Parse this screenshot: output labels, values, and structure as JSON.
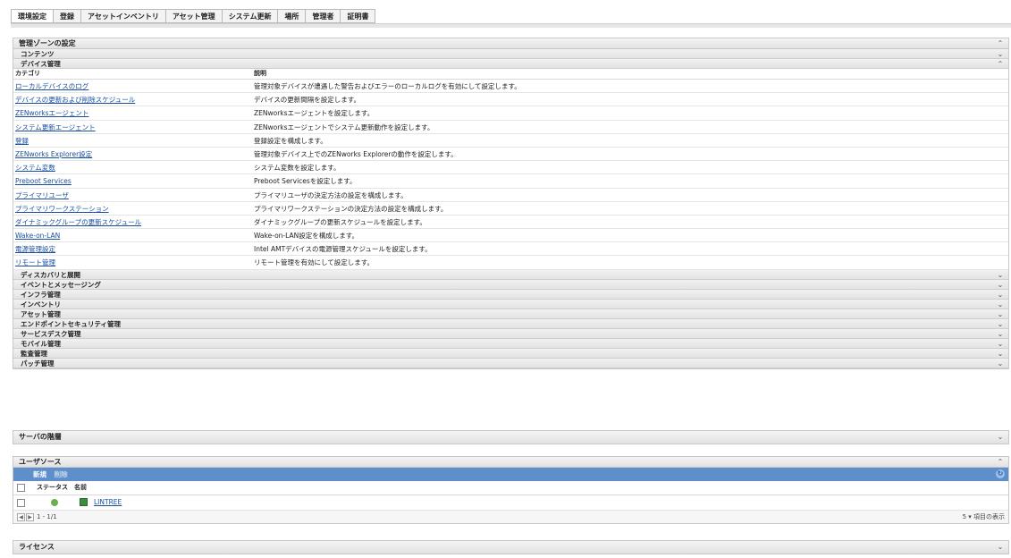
{
  "tabs": [
    "環境設定",
    "登録",
    "アセットインベントリ",
    "アセット管理",
    "システム更新",
    "場所",
    "管理者",
    "証明書"
  ],
  "zone": {
    "title": "管理ゾーンの設定",
    "sections_top": [
      "コンテンツ",
      "デバイス管理"
    ],
    "columns": {
      "category": "カテゴリ",
      "description": "説明"
    },
    "rows": [
      {
        "link": "ローカルデバイスのログ",
        "desc": "管理対象デバイスが遭遇した警告およびエラーのローカルログを有効にして設定します。"
      },
      {
        "link": "デバイスの更新および削除スケジュール",
        "desc": "デバイスの更新間隔を設定します。"
      },
      {
        "link": "ZENworksエージェント",
        "desc": "ZENworksエージェントを設定します。"
      },
      {
        "link": "システム更新エージェント",
        "desc": "ZENworksエージェントでシステム更新動作を設定します。"
      },
      {
        "link": "登録",
        "desc": "登録設定を構成します。"
      },
      {
        "link": "ZENworks Explorer設定",
        "desc": "管理対象デバイス上でのZENworks Explorerの動作を設定します。"
      },
      {
        "link": "システム変数",
        "desc": "システム変数を設定します。"
      },
      {
        "link": "Preboot Services",
        "desc": "Preboot Servicesを設定します。"
      },
      {
        "link": "プライマリユーザ",
        "desc": "プライマリユーザの決定方法の設定を構成します。"
      },
      {
        "link": "プライマリワークステーション",
        "desc": "プライマリワークステーションの決定方法の設定を構成します。"
      },
      {
        "link": "ダイナミックグループの更新スケジュール",
        "desc": "ダイナミックグループの更新スケジュールを設定します。"
      },
      {
        "link": "Wake-on-LAN",
        "desc": "Wake-on-LAN設定を構成します。"
      },
      {
        "link": "電源管理設定",
        "desc": "Intel AMTデバイスの電源管理スケジュールを設定します。"
      },
      {
        "link": "リモート管理",
        "desc": "リモート管理を有効にして設定します。"
      }
    ],
    "sections_bottom": [
      "ディスカバリと展開",
      "イベントとメッセージング",
      "インフラ管理",
      "インベントリ",
      "アセット管理",
      "エンドポイントセキュリティ管理",
      "サービスデスク管理",
      "モバイル管理",
      "監査管理",
      "パッチ管理"
    ]
  },
  "server_hierarchy": {
    "title": "サーバの階層"
  },
  "user_source": {
    "title": "ユーザソース",
    "actions": [
      "新規",
      "削除"
    ],
    "columns": {
      "status": "ステータス",
      "name": "名前"
    },
    "rows": [
      {
        "name": "LINTREE"
      }
    ],
    "pager": "1 - 1/1",
    "page_size": "5 ▾ 項目の表示"
  },
  "license": {
    "title": "ライセンス"
  },
  "icons": {
    "expand": "chevron-up-icon",
    "collapse": "chevron-down-icon"
  },
  "colors": {
    "accent": "#5f8fcb",
    "link": "#1a4fa0"
  }
}
